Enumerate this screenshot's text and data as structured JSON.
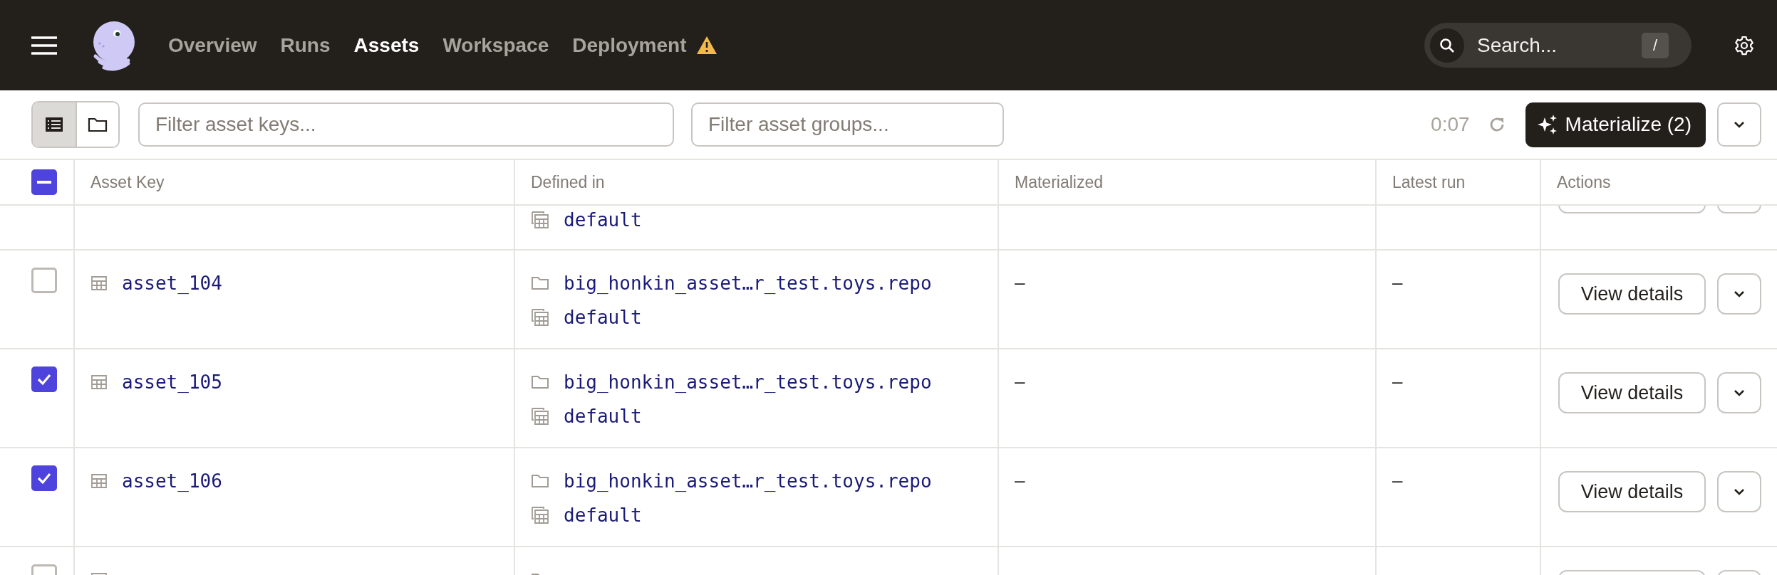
{
  "nav": {
    "items": [
      {
        "label": "Overview",
        "selected": false,
        "warning": false
      },
      {
        "label": "Runs",
        "selected": false,
        "warning": false
      },
      {
        "label": "Assets",
        "selected": true,
        "warning": false
      },
      {
        "label": "Workspace",
        "selected": false,
        "warning": false
      },
      {
        "label": "Deployment",
        "selected": false,
        "warning": true
      }
    ],
    "search": {
      "placeholder": "Search...",
      "shortcut": "/"
    }
  },
  "toolbar": {
    "views": [
      {
        "kind": "list",
        "selected": true
      },
      {
        "kind": "folder",
        "selected": false
      }
    ],
    "asset_filter": {
      "placeholder": "Filter asset keys..."
    },
    "group_filter": {
      "placeholder": "Filter asset groups..."
    },
    "refresh_timer": "0:07",
    "materialize_button": "Materialize (2)"
  },
  "table": {
    "select_all": {
      "indeterminate": true
    },
    "columns": [
      "Asset Key",
      "Defined in",
      "Materialized",
      "Latest run",
      "Actions"
    ],
    "rows": [
      {
        "kind": "cut_top",
        "group": "default"
      },
      {
        "kind": "full",
        "checked": false,
        "asset_key": "asset_104",
        "code_location": "big_honkin_asset…r_test.toys.repo",
        "group": "default",
        "materialized": "–",
        "latest_run": "–",
        "action": "View details"
      },
      {
        "kind": "full",
        "checked": true,
        "asset_key": "asset_105",
        "code_location": "big_honkin_asset…r_test.toys.repo",
        "group": "default",
        "materialized": "–",
        "latest_run": "–",
        "action": "View details"
      },
      {
        "kind": "full",
        "checked": true,
        "asset_key": "asset_106",
        "code_location": "big_honkin_asset…r_test.toys.repo",
        "group": "default",
        "materialized": "–",
        "latest_run": "–",
        "action": "View details"
      },
      {
        "kind": "cut_bottom",
        "checked": false
      }
    ]
  }
}
